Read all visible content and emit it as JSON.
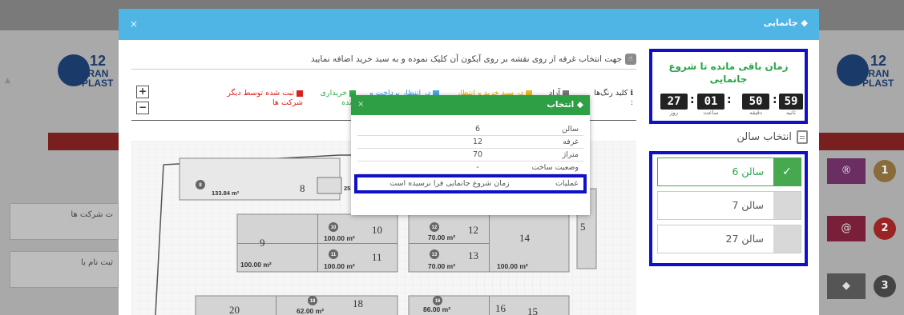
{
  "modal": {
    "title": "جانمایی",
    "close": "×"
  },
  "instruction": "جهت انتخاب غرفه از روی نقشه بر روی آیکون آن کلیک نموده و به سبد خرید اضافه نمایید",
  "legend": {
    "title": "کلید رنگ‌ها",
    "items": [
      {
        "label": "آزاد",
        "color": "#777777"
      },
      {
        "label": "در سبد خرید و انتظار",
        "color": "#e7c11a"
      },
      {
        "label": "در انتظار پرداخت و",
        "color": "#4aa7e0"
      },
      {
        "label": "خریداری شده",
        "color": "#2eae45"
      },
      {
        "label": "ثبت شده توسط دیگر شرکت ها",
        "color": "#d92020"
      }
    ],
    "zoom_in": "+",
    "zoom_out": "−"
  },
  "popup": {
    "title": "انتخاب",
    "close": "×",
    "rows": [
      {
        "key": "سالن",
        "value": "6"
      },
      {
        "key": "غرفه",
        "value": "12"
      },
      {
        "key": "متراژ",
        "value": "70"
      },
      {
        "key": "وضعیت ساخت",
        "value": "-"
      },
      {
        "key": "عملیات",
        "value": "زمان شروع جانمایی فرا نرسیده است"
      }
    ]
  },
  "timer": {
    "title": "زمان باقی مانده تا شروع جانمایی",
    "days": "27",
    "hours": "01",
    "minutes": "50",
    "seconds": "59",
    "day_label": "روز",
    "hour_label": "ساعت",
    "minute_label": "دقیقه",
    "second_label": "ثانیه"
  },
  "hall_section": {
    "title": "انتخاب سالن",
    "items": [
      {
        "label": "سالن 6",
        "selected": true,
        "check": "✓"
      },
      {
        "label": "سالن 7",
        "selected": false,
        "check": ""
      },
      {
        "label": "سالن 27",
        "selected": false,
        "check": ""
      }
    ]
  },
  "map": {
    "booths": [
      {
        "num": "8",
        "area": "133.84 m²"
      },
      {
        "num": "9",
        "area": "100.00 m²"
      },
      {
        "num": "10",
        "area": "100.00 m²"
      },
      {
        "num": "11",
        "area": "100.00 m²"
      },
      {
        "num": "12",
        "area": "70.00 m²"
      },
      {
        "num": "13",
        "area": "70.00 m²"
      },
      {
        "num": "14",
        "area": "100.00 m²"
      },
      {
        "num": "5",
        "area": ""
      },
      {
        "num": "15",
        "area": ""
      },
      {
        "num": "16",
        "area": "86.00 m²"
      },
      {
        "num": "18",
        "area": "62.00 m²"
      },
      {
        "num": "20",
        "area": ""
      }
    ],
    "badges": [
      "8",
      "10",
      "11",
      "12",
      "13",
      "18",
      "16"
    ],
    "partial_label": "25."
  },
  "background": {
    "left_card_1": "ت شرکت ها",
    "left_card_2": "ثبت نام با",
    "steps": [
      "1",
      "2",
      "3"
    ]
  }
}
